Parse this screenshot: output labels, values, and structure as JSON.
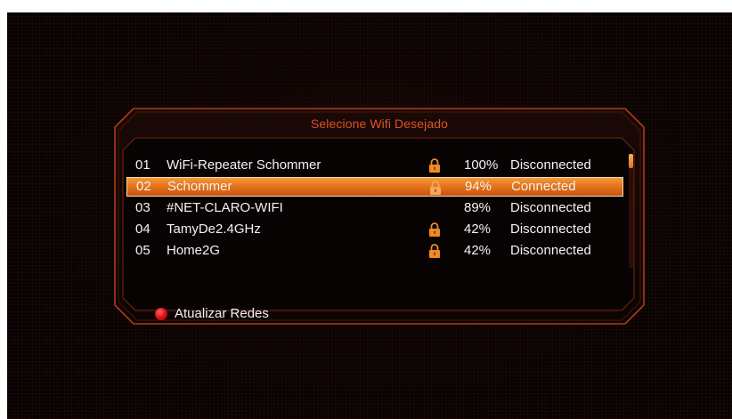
{
  "dialog": {
    "title": "Selecione Wifi Desejado"
  },
  "networks": [
    {
      "index": "01",
      "ssid": "WiFi-Repeater Schommer",
      "locked": true,
      "signal": "100%",
      "status": "Disconnected",
      "selected": false
    },
    {
      "index": "02",
      "ssid": "Schommer",
      "locked": true,
      "signal": "94%",
      "status": "Connected",
      "selected": true
    },
    {
      "index": "03",
      "ssid": "#NET-CLARO-WIFI",
      "locked": false,
      "signal": "89%",
      "status": "Disconnected",
      "selected": false
    },
    {
      "index": "04",
      "ssid": "TamyDe2.4GHz",
      "locked": true,
      "signal": "42%",
      "status": "Disconnected",
      "selected": false
    },
    {
      "index": "05",
      "ssid": "Home2G",
      "locked": true,
      "signal": "42%",
      "status": "Disconnected",
      "selected": false
    }
  ],
  "actions": {
    "refresh_label": "Atualizar Redes",
    "refresh_key_color": "#e3131a"
  },
  "colors": {
    "accent": "#e0531f",
    "selection": "#e6741c",
    "lock": "#f08a24"
  }
}
